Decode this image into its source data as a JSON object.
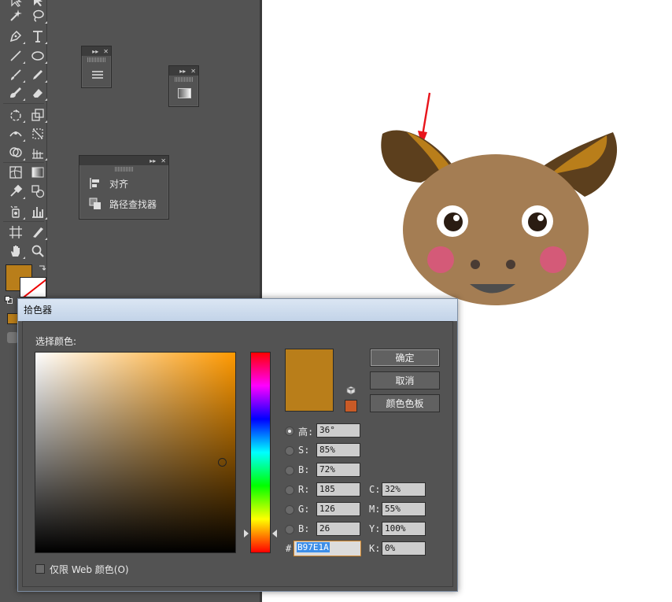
{
  "canvas": {
    "background": "#ffffff"
  },
  "colors": {
    "ui_bg": "#535353",
    "current_fill": "#b97e1a",
    "gamut_warning": "#c95a26",
    "annotation_arrow": "#e8141b",
    "cow_face": "#a47d53",
    "horn_outer": "#5c3f1d",
    "horn_inner": "#b97e1a",
    "cheek": "#d45a78"
  },
  "panels": {
    "floating": [
      {
        "icon": "align-icon",
        "label": "对齐"
      },
      {
        "icon": "pathfinder-icon",
        "label": "路径查找器"
      }
    ]
  },
  "dialog": {
    "title": "拾色器",
    "select_label": "选择颜色:",
    "buttons": {
      "ok": "确定",
      "cancel": "取消",
      "swatches": "颜色色板"
    },
    "hsb": [
      {
        "label": "高:",
        "value": "36°",
        "selected": true
      },
      {
        "label": "S:",
        "value": "85%",
        "selected": false
      },
      {
        "label": "B:",
        "value": "72%",
        "selected": false
      }
    ],
    "rgb": [
      {
        "label": "R:",
        "value": "185",
        "selected": false
      },
      {
        "label": "G:",
        "value": "126",
        "selected": false
      },
      {
        "label": "B:",
        "value": "26",
        "selected": false
      }
    ],
    "cmyk": [
      {
        "label": "C:",
        "value": "32%"
      },
      {
        "label": "M:",
        "value": "55%"
      },
      {
        "label": "Y:",
        "value": "100%"
      },
      {
        "label": "K:",
        "value": "0%"
      }
    ],
    "hex_label": "#",
    "hex_value": "B97E1A",
    "web_only_label": "仅限 Web 颜色(O)",
    "web_only_checked": false
  }
}
